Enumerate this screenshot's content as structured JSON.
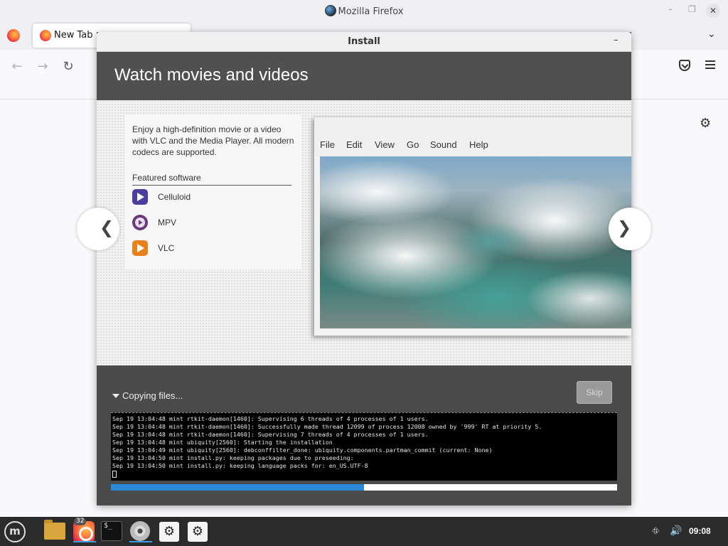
{
  "browser": {
    "window_title": "Mozilla Firefox",
    "tab_label": "New Tab",
    "controls": {
      "minimize": "–",
      "maximize": "❐",
      "close": "✕"
    },
    "nav": {
      "back": "←",
      "forward": "→",
      "reload": "↻",
      "tab_list": "⌄"
    }
  },
  "dialog": {
    "title": "Install",
    "minimize": "–",
    "heading": "Watch movies and videos",
    "slide": {
      "description": "Enjoy a high-definition movie or a video with VLC and the Media Player. All modern codecs are supported.",
      "featured_label": "Featured software",
      "software": [
        {
          "name": "Celluloid",
          "icon": "celluloid-icon",
          "color": "#4a3f9a"
        },
        {
          "name": "MPV",
          "icon": "mpv-icon",
          "color": "#6b3a7e"
        },
        {
          "name": "VLC",
          "icon": "vlc-icon",
          "color": "#e8811c"
        }
      ],
      "player_menu": [
        "File",
        "Edit",
        "View",
        "Go",
        "Sound",
        "Help"
      ],
      "prev_arrow": "❮",
      "next_arrow": "❯"
    },
    "status": "Copying files...",
    "skip_label": "Skip",
    "log_lines": [
      "Sep 19 13:04:48 mint rtkit-daemon[1460]: Supervising 6 threads of 4 processes of 1 users.",
      "Sep 19 13:04:48 mint rtkit-daemon[1460]: Successfully made thread 12099 of process 12008 owned by '999' RT at priority 5.",
      "Sep 19 13:04:48 mint rtkit-daemon[1460]: Supervising 7 threads of 4 processes of 1 users.",
      "Sep 19 13:04:48 mint ubiquity[2560]: Starting the installation",
      "Sep 19 13:04:49 mint ubiquity[2560]: debconffilter_done: ubiquity.components.partman_commit (current: None)",
      "Sep 19 13:04:50 mint install.py: keeping packages due to preseeding:",
      "Sep 19 13:04:50 mint install.py: keeping language packs for: en_US.UTF-8"
    ],
    "progress_fraction": 0.5,
    "progress_color": "#2b89d8"
  },
  "taskbar": {
    "menu_glyph": "m",
    "firefox_badge": "32",
    "terminal_glyph": "$_",
    "settings_glyph": "⚙",
    "clock": "09:08"
  }
}
